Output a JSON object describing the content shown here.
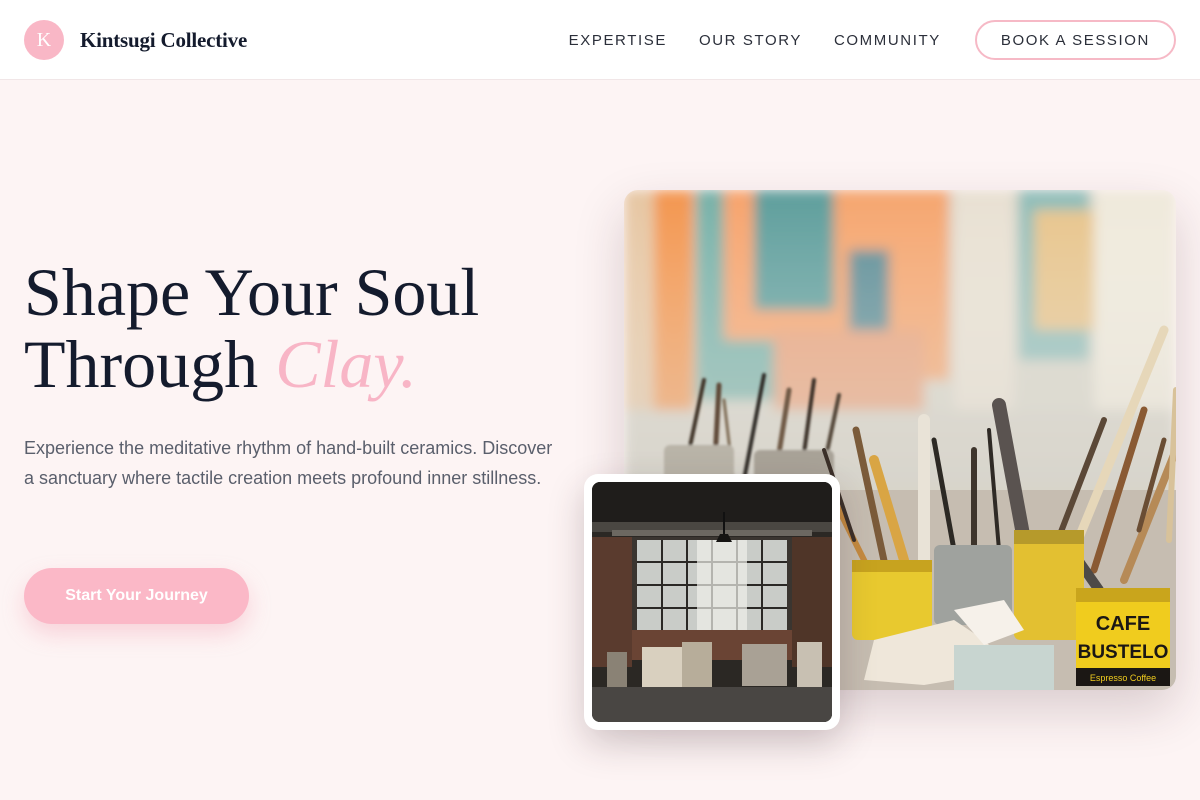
{
  "header": {
    "logo_letter": "K",
    "brand_name": "Kintsugi Collective",
    "nav": [
      {
        "label": "EXPERTISE"
      },
      {
        "label": "OUR STORY"
      },
      {
        "label": "COMMUNITY"
      }
    ],
    "book_label": "BOOK A SESSION"
  },
  "hero": {
    "title_line1": "Shape Your Soul",
    "title_line2": "Through ",
    "title_accent": "Clay.",
    "subtitle": "Experience the meditative rhythm of hand-built ceramics. Discover a sanctuary where tactile creation meets profound inner stillness.",
    "cta_label": "Start Your Journey"
  },
  "images": {
    "main": "paint-brushes-in-cans-photo",
    "inset": "industrial-studio-interior-photo",
    "can_text_1": "CAFE",
    "can_text_2": "BUSTELO",
    "can_text_3": "Espresso Coffee"
  },
  "colors": {
    "accent_pink": "#f8b5c6",
    "background": "#fdf4f4",
    "text_dark": "#141b2d"
  }
}
